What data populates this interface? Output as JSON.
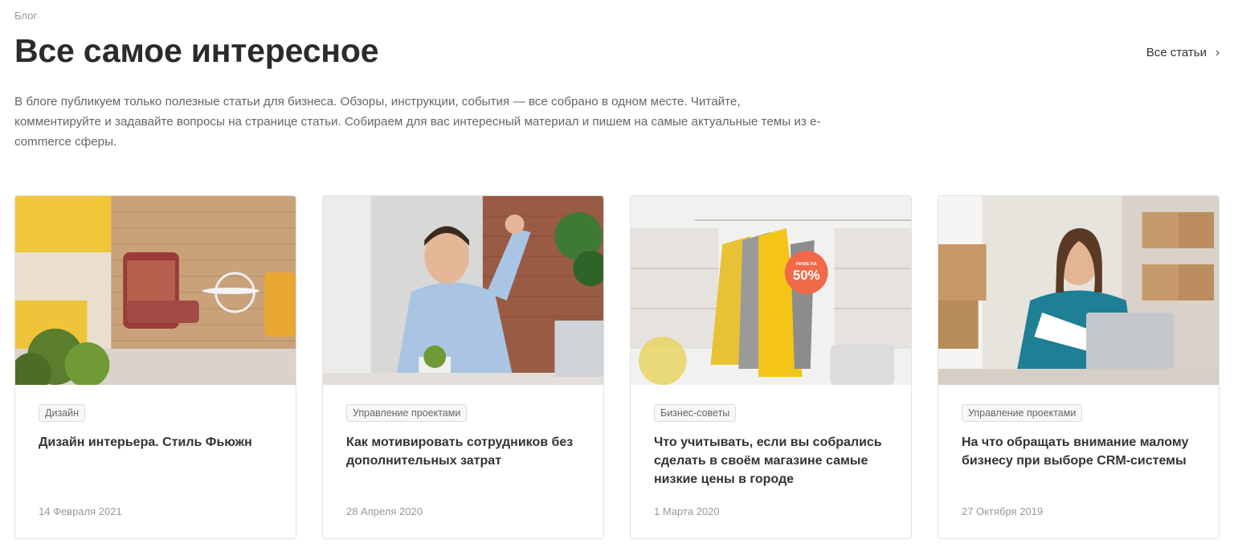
{
  "breadcrumb": "Блог",
  "title": "Все самое интересное",
  "all_articles_link": "Все статьи",
  "intro": "В блоге публикуем только полезные статьи для бизнеса. Обзоры, инструкции, события — все собрано в одном месте. Читайте, комментируйте и задавайте вопросы на странице статьи. Собираем для вас интересный материал и пишем на самые актуальные темы из e-commerce сферы.",
  "cards": [
    {
      "tag": "Дизайн",
      "title": "Дизайн интерьера. Стиль Фьюжн",
      "date": "14 Февраля 2021",
      "image": "interior-armchair-photo"
    },
    {
      "tag": "Управление проектами",
      "title": "Как мотивировать сотрудников без дополнительных затрат",
      "date": "28 Апреля 2020",
      "image": "happy-man-on-phone-photo"
    },
    {
      "tag": "Бизнес-советы",
      "title": "Что учитывать, если вы собрались сделать в своём магазине самые низкие цены в городе",
      "date": "1 Марта 2020",
      "image": "sale-clothes-rack-photo",
      "badge_small": "НИЖЕ НА",
      "badge_big": "50%"
    },
    {
      "tag": "Управление проектами",
      "title": "На что обращать внимание малому бизнесу при выборе CRM-системы",
      "date": "27 Октября 2019",
      "image": "woman-with-laptop-photo"
    }
  ],
  "colors": {
    "sale_badge": "#f06a4a",
    "text": "#333333",
    "muted": "#999999"
  }
}
